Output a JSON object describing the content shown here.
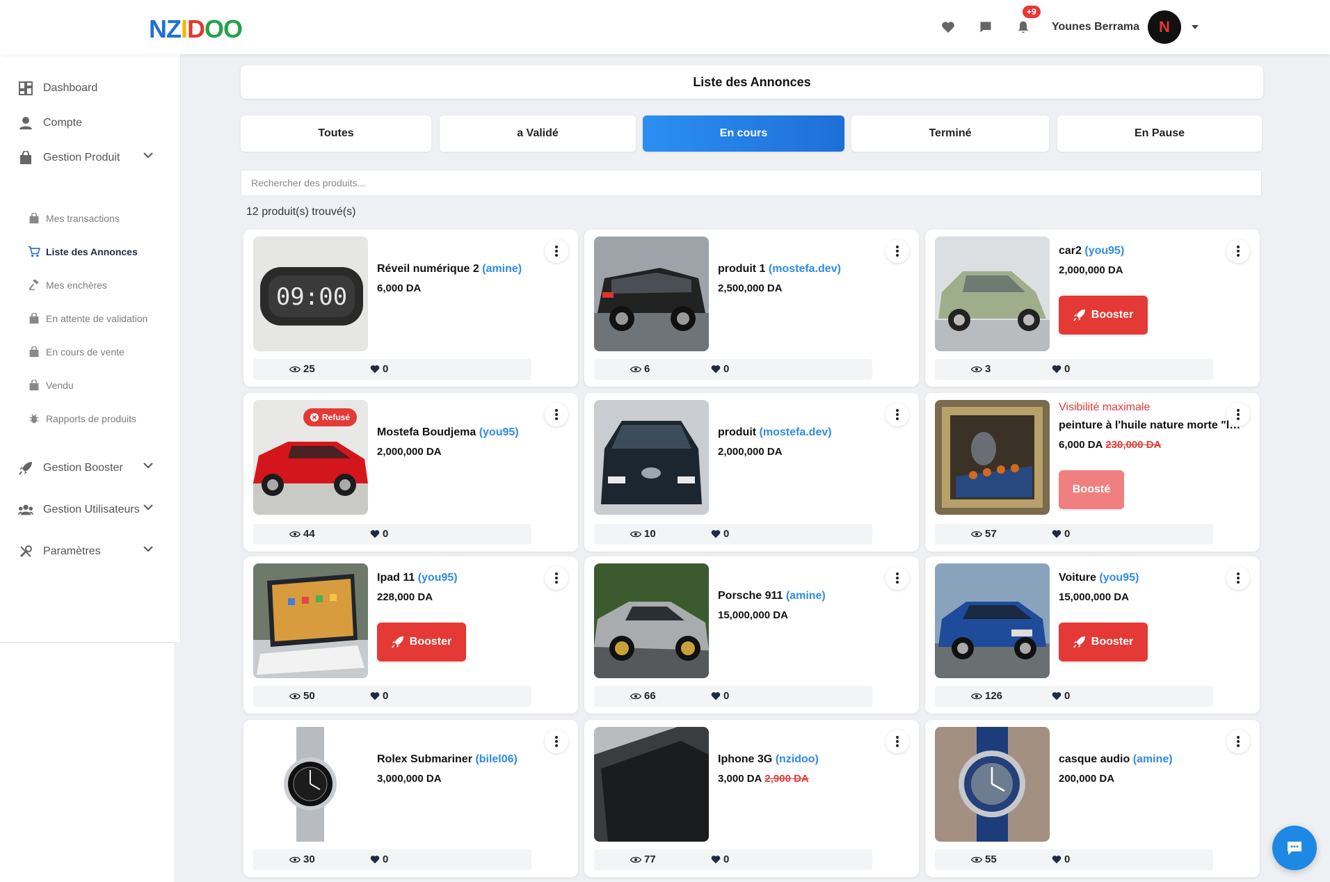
{
  "app": {
    "logo_text": [
      "N",
      "Z",
      "I",
      "D",
      "OO"
    ],
    "user_name": "Younes Berrama",
    "notifications_badge": "+9"
  },
  "sidebar": {
    "items": [
      {
        "label": "Dashboard",
        "icon": "dashboard-icon"
      },
      {
        "label": "Compte",
        "icon": "user-icon"
      },
      {
        "label": "Gestion Produit",
        "icon": "bag-icon"
      },
      {
        "label": "Gestion Booster",
        "icon": "rocket-icon"
      },
      {
        "label": "Gestion Utilisateurs",
        "icon": "users-icon"
      },
      {
        "label": "Paramètres",
        "icon": "tools-icon"
      }
    ],
    "sub_items": [
      {
        "label": "Mes transactions",
        "icon": "bag-icon"
      },
      {
        "label": "Liste des Annonces",
        "icon": "cart-icon",
        "active": true
      },
      {
        "label": "Mes enchères",
        "icon": "gavel-icon"
      },
      {
        "label": "En attente de validation",
        "icon": "bag-icon"
      },
      {
        "label": "En cours de vente",
        "icon": "bag-icon"
      },
      {
        "label": "Vendu",
        "icon": "bag-icon"
      },
      {
        "label": "Rapports de produits",
        "icon": "bug-icon"
      }
    ]
  },
  "main": {
    "title": "Liste des Annonces",
    "tabs": [
      {
        "label": "Toutes"
      },
      {
        "label": "a Validé"
      },
      {
        "label": "En cours",
        "active": true
      },
      {
        "label": "Terminé"
      },
      {
        "label": "En Pause"
      }
    ],
    "search_placeholder": "Rechercher des produits...",
    "count_text": "12 produit(s) trouvé(s)",
    "boost_label": "Booster",
    "boosted_label": "Boosté",
    "refused_label": "Refusé",
    "promo_label": "Visibilité maximale"
  },
  "products": [
    {
      "title": "Réveil numérique 2",
      "seller": "(amine)",
      "price": "6,000 DA",
      "old_price": "",
      "views": "25",
      "likes": "0",
      "boost": "none",
      "thumb": "clock"
    },
    {
      "title": "produit 1",
      "seller": "(mostefa.dev)",
      "price": "2,500,000 DA",
      "old_price": "",
      "views": "6",
      "likes": "0",
      "boost": "none",
      "thumb": "suv"
    },
    {
      "title": "car2",
      "seller": "(you95)",
      "price": "2,000,000 DA",
      "old_price": "",
      "views": "3",
      "likes": "0",
      "boost": "button",
      "thumb": "greencar"
    },
    {
      "title": "Mostefa Boudjema",
      "seller": "(you95)",
      "price": "2,000,000 DA",
      "old_price": "",
      "views": "44",
      "likes": "0",
      "boost": "none",
      "thumb": "redcar",
      "refused": true
    },
    {
      "title": "produit",
      "seller": "(mostefa.dev)",
      "price": "2,000,000 DA",
      "old_price": "",
      "views": "10",
      "likes": "0",
      "boost": "none",
      "thumb": "leaf"
    },
    {
      "title": "peinture à l'huile nature morte \"le ...",
      "seller": "",
      "price": "6,000 DA",
      "old_price": "230,000 DA",
      "views": "57",
      "likes": "0",
      "boost": "boosted",
      "thumb": "painting",
      "promo": true
    },
    {
      "title": "Ipad 11",
      "seller": "(you95)",
      "price": "228,000 DA",
      "old_price": "",
      "views": "50",
      "likes": "0",
      "boost": "button",
      "thumb": "ipad"
    },
    {
      "title": "Porsche 911",
      "seller": "(amine)",
      "price": "15,000,000 DA",
      "old_price": "",
      "views": "66",
      "likes": "0",
      "boost": "none",
      "thumb": "porsche"
    },
    {
      "title": "Voiture",
      "seller": "(you95)",
      "price": "15,000,000 DA",
      "old_price": "",
      "views": "126",
      "likes": "0",
      "boost": "button",
      "thumb": "audi"
    },
    {
      "title": "Rolex Submariner",
      "seller": "(bilel06)",
      "price": "3,000,000 DA",
      "old_price": "",
      "views": "30",
      "likes": "0",
      "boost": "none",
      "thumb": "rolex"
    },
    {
      "title": "Iphone 3G",
      "seller": "(nzidoo)",
      "price": "3,000 DA",
      "old_price": "2,900 DA",
      "views": "77",
      "likes": "0",
      "boost": "none",
      "thumb": "iphone"
    },
    {
      "title": "casque audio",
      "seller": "(amine)",
      "price": "200,000 DA",
      "old_price": "",
      "views": "55",
      "likes": "0",
      "boost": "none",
      "thumb": "watch"
    }
  ],
  "colors": {
    "accent": "#1e88e5",
    "danger": "#e53935",
    "seller": "#2e8be6"
  }
}
